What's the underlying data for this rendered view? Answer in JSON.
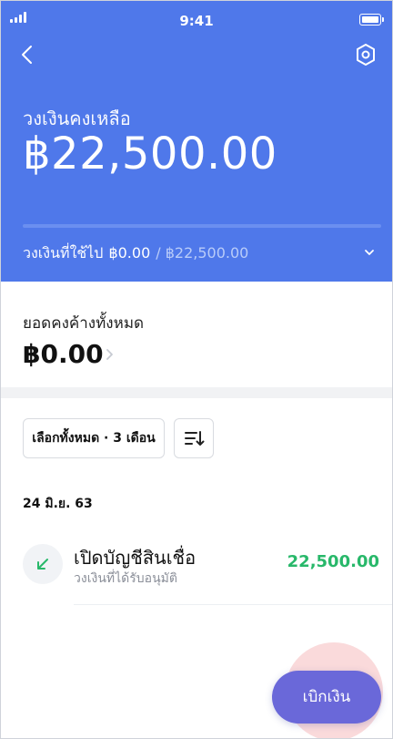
{
  "status_bar": {
    "time": "9:41"
  },
  "header": {
    "back_icon": "chevron-left-icon",
    "settings_icon": "hexagon-gear-icon",
    "available_label": "วงเงินคงเหลือ",
    "available_amount": "฿22,500.00",
    "usage_label": "วงเงินที่ใช้ไป",
    "usage_used": "฿0.00",
    "usage_total": "/ ฿22,500.00",
    "usage_fraction": 0.98,
    "expand_icon": "chevron-down-icon"
  },
  "outstanding": {
    "label": "ยอดคงค้างทั้งหมด",
    "amount": "฿0.00",
    "chevron_icon": "chevron-right-icon"
  },
  "filters": {
    "period_label": "เลือกทั้งหมด · 3 เดือน",
    "sort_icon": "sort-icon"
  },
  "transactions": {
    "date_header": "24 มิ.ย. 63",
    "items": [
      {
        "title": "เปิดบัญชีสินเชื่อ",
        "subtitle": "วงเงินที่ได้รับอนุมัติ",
        "amount": "22,500.00",
        "icon": "arrow-down-left-icon",
        "amount_color": "#28b86a"
      }
    ]
  },
  "fab": {
    "label": "เบิกเงิน"
  },
  "colors": {
    "primary": "#4f78ea",
    "positive": "#28b86a",
    "fab": "#6a68d9"
  }
}
